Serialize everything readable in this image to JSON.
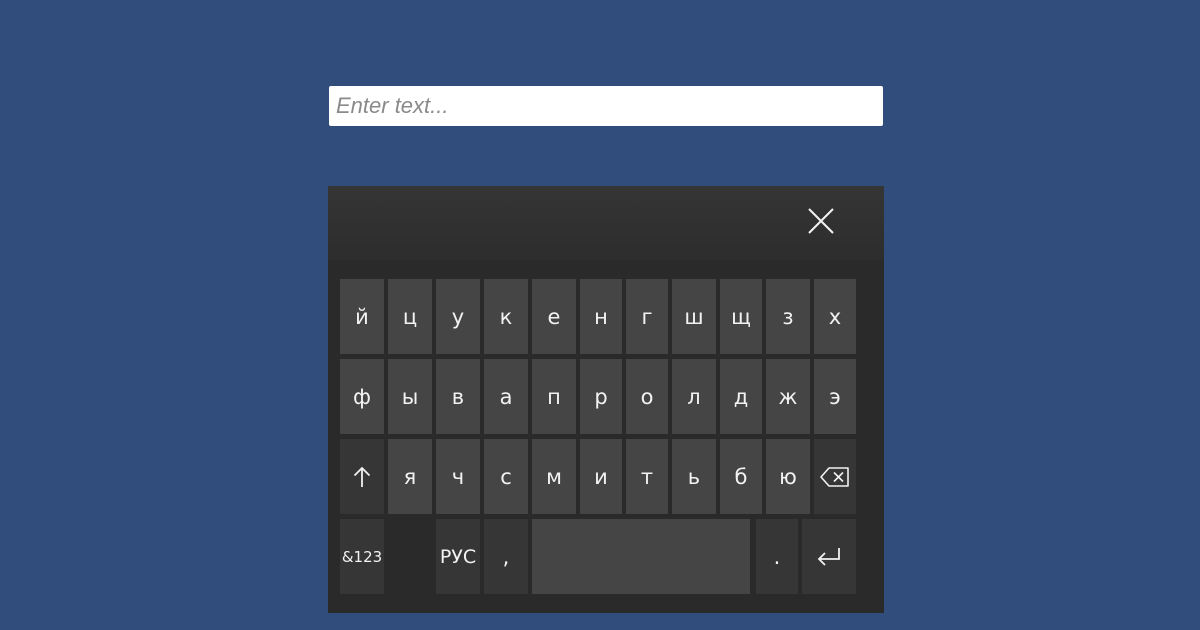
{
  "input": {
    "placeholder": "Enter text...",
    "value": ""
  },
  "keyboard": {
    "close_icon": "close-icon",
    "rows": [
      [
        "й",
        "ц",
        "у",
        "к",
        "е",
        "н",
        "г",
        "ш",
        "щ",
        "з",
        "х"
      ],
      [
        "ф",
        "ы",
        "в",
        "а",
        "п",
        "р",
        "о",
        "л",
        "д",
        "ж",
        "э"
      ],
      [
        "я",
        "ч",
        "с",
        "м",
        "и",
        "т",
        "ь",
        "б",
        "ю"
      ]
    ],
    "shift_icon": "arrow-up-icon",
    "backspace_icon": "backspace-icon",
    "symbols_label": "&123",
    "language_label": "РУС",
    "comma_label": ",",
    "period_label": ".",
    "enter_icon": "enter-icon"
  },
  "colors": {
    "page_background": "#314d7b",
    "keyboard_background": "#2a2a2a",
    "key_background": "#454545",
    "function_key_background": "#363636",
    "key_text": "#f2f2f2"
  }
}
